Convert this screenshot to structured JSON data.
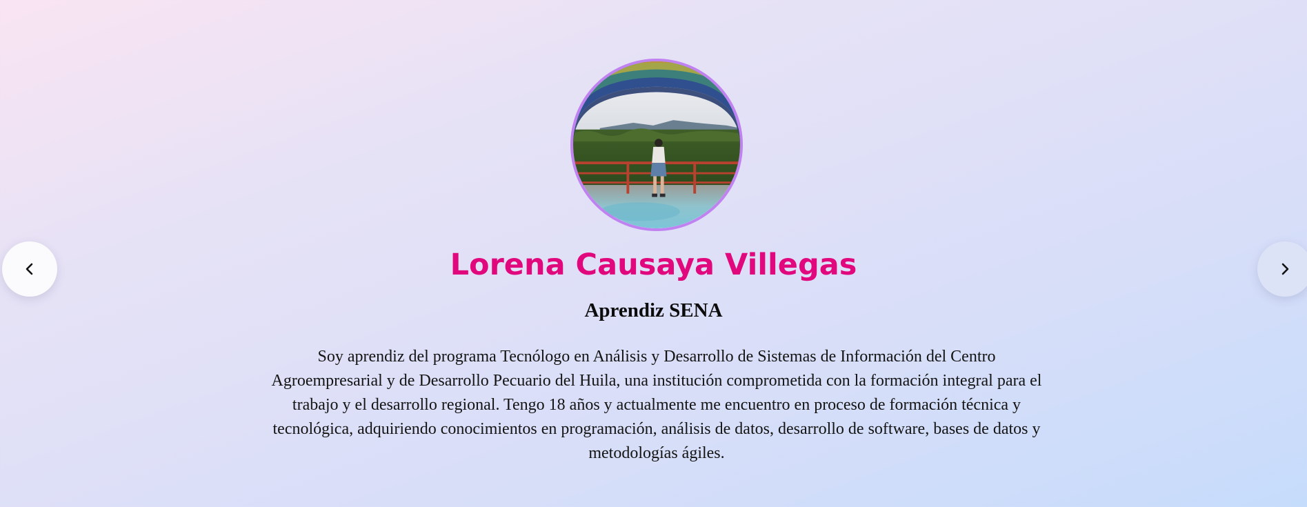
{
  "profile": {
    "photo_alt": "Foto de perfil",
    "name": "Lorena Causaya Villegas",
    "role": "Aprendiz SENA",
    "bio": "Soy aprendiz del programa Tecnólogo en Análisis y Desarrollo de Sistemas de Información del Centro Agroempresarial y de Desarrollo Pecuario del Huila, una institución comprometida con la formación integral para el trabajo y el desarrollo regional. Tengo 18 años y actualmente me encuentro en proceso de formación técnica y tecnológica, adquiriendo conocimientos en programación, análisis de datos, desarrollo de software, bases de datos y metodologías ágiles."
  },
  "navigation": {
    "prev_icon": "chevron-left-icon",
    "next_icon": "chevron-right-icon"
  },
  "colors": {
    "name": "#e0087c",
    "avatar_border": "#c081f1",
    "background_start": "#f9e4f2",
    "background_end": "#c6dcfb"
  }
}
